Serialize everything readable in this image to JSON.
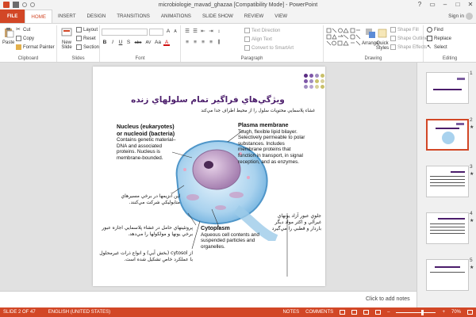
{
  "window": {
    "title": "microbiologie_mavad_ghazaa [Compatibility Mode] - PowerPoint",
    "controls": [
      "?",
      "▭",
      "–",
      "□",
      "✕"
    ]
  },
  "tabs": [
    "FILE",
    "HOME",
    "INSERT",
    "DESIGN",
    "TRANSITIONS",
    "ANIMATIONS",
    "SLIDE SHOW",
    "REVIEW",
    "VIEW"
  ],
  "active_tab": "HOME",
  "account": {
    "sign_in": "Sign in"
  },
  "ribbon": {
    "clipboard": {
      "label": "Clipboard",
      "paste": "Paste",
      "cut": "Cut",
      "copy": "Copy",
      "format_painter": "Format Painter"
    },
    "slides": {
      "label": "Slides",
      "new_slide": "New Slide",
      "layout": "Layout",
      "reset": "Reset",
      "section": "Section"
    },
    "font": {
      "label": "Font",
      "buttons": [
        "B",
        "I",
        "U",
        "S",
        "abc",
        "AV",
        "Aa",
        "A"
      ]
    },
    "paragraph": {
      "label": "Paragraph",
      "text_direction": "Text Direction",
      "align_text": "Align Text",
      "convert_smartart": "Convert to SmartArt"
    },
    "drawing": {
      "label": "Drawing",
      "arrange": "Arrange",
      "quick_styles": "Quick Styles",
      "shape_fill": "Shape Fill",
      "shape_outline": "Shape Outline",
      "shape_effects": "Shape Effects"
    },
    "editing": {
      "label": "Editing",
      "find": "Find",
      "replace": "Replace",
      "select": "Select"
    }
  },
  "slide": {
    "title": "ويژگي‌هاي فراگير تمام سلولهاي زنده",
    "subtitle": "غشاء پلاسمايي محتويات سلول را از محيط اطراف جدا مي‌كند",
    "nucleus_title": "Nucleus (eukaryotes) or nucleoid (bacteria)",
    "nucleus_body": "Contains genetic material–DNA and associated proteins. Nucleus is membrane-bounded.",
    "membrane_title": "Plasma membrane",
    "membrane_body": "Tough, flexible lipid bilayer. Selectively permeable to polar substances. Includes membrane proteins that function in transport, in signal reception, and as enzymes.",
    "cytoplasm_title": "Cytoplasm",
    "cytoplasm_body": "Aqueous cell contents and suspended particles and organelles.",
    "fa_enzymes": "اين آنزيمها در برخي مسيرهاي متابوليكي شركت مي‌كنند.",
    "fa_proteins": "پروتئينهاي حامل در غشاء پلاسمايي اجازه عبور برخي يونها و مولكولها را مي‌دهد.",
    "fa_cytosol": "از cytosol (بخش آبي) و انواع ذرات غيرمحلول با عملكرد خاص تشكيل شده است.",
    "fa_channels": "جلوي عبور آزاد يونهاي غيرآلي و اكثر مواد ديگر باردار و قطبي را مي‌گيرد",
    "dot_colors": [
      "#5b2c83",
      "#7e57a8",
      "#a08cc0",
      "#c9c06a",
      "#d9d19a",
      "#b6a2d2"
    ]
  },
  "notes_placeholder": "Click to add notes",
  "thumbnails": [
    {
      "num": "1",
      "star": ""
    },
    {
      "num": "2",
      "star": "★"
    },
    {
      "num": "3",
      "star": "★"
    },
    {
      "num": "4",
      "star": "★"
    },
    {
      "num": "5",
      "star": "★"
    }
  ],
  "status": {
    "slide_of": "SLIDE 2 OF 47",
    "language": "ENGLISH (UNITED STATES)",
    "notes": "NOTES",
    "comments": "COMMENTS",
    "zoom": "70%"
  },
  "colors": {
    "accent": "#d24726",
    "title_purple": "#4b1d6b"
  }
}
